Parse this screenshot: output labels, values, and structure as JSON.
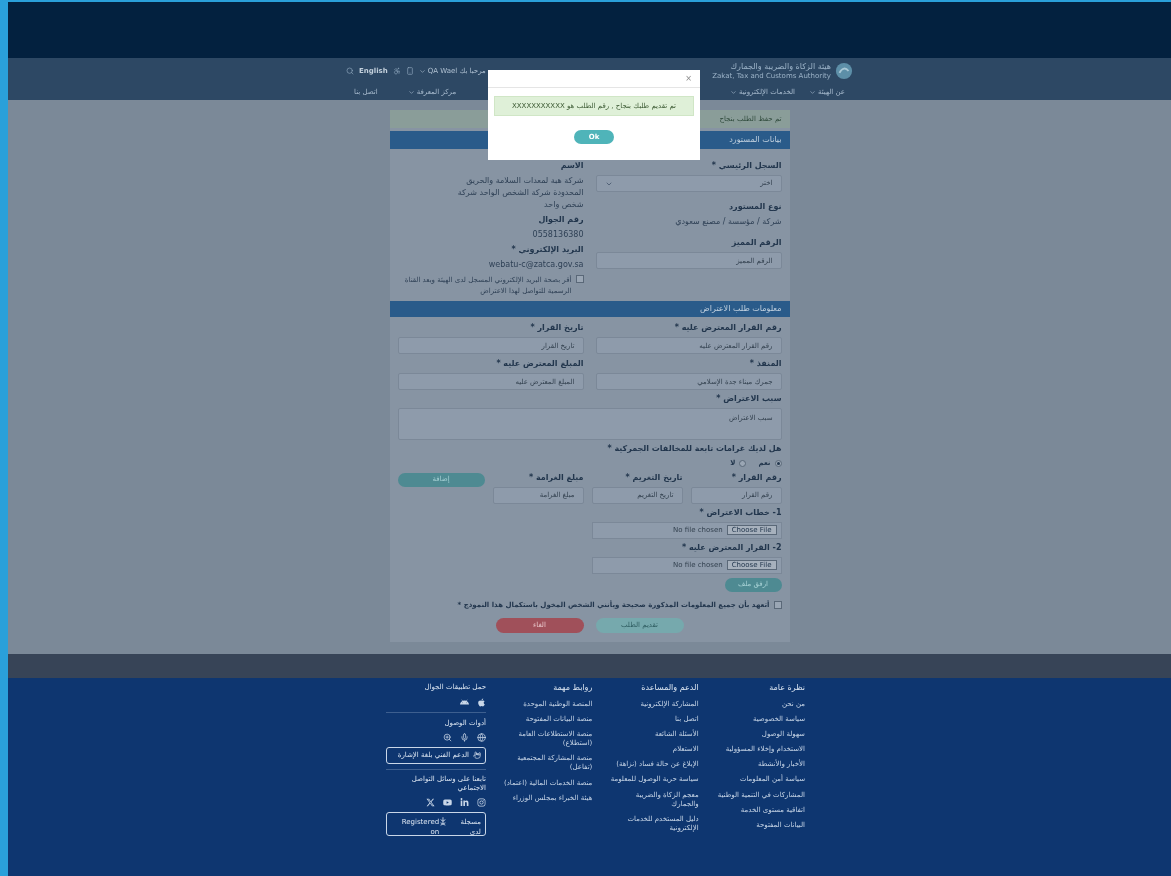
{
  "header": {
    "logo_title": "هيئة الزكاة والضريبة والجمارك",
    "logo_subtitle": "Zakat, Tax and Customs Authority",
    "greeting": "مرحبا بك QA Wael",
    "language": "English",
    "nav": [
      {
        "label": "عن الهيئة",
        "has_menu": true
      },
      {
        "label": "الخدمات الإلكترونية",
        "has_menu": true
      },
      {
        "label": "مركز المعرفة",
        "has_menu": true
      },
      {
        "label": "اتصل بنا",
        "has_menu": false
      }
    ]
  },
  "modal": {
    "close": "×",
    "message": "تم تقديم طلبك بنجاح , رقم الطلب هو XXXXXXXXXXX",
    "button": "Ok"
  },
  "form": {
    "alert": "تم حفظ الطلب بنجاح",
    "importer": {
      "title": "بيانات المستورد",
      "right_column": [
        {
          "kind": "select",
          "label": "السجل الرئيسي *",
          "value": "اختر"
        },
        {
          "kind": "readonly",
          "label": "نوع المستورد",
          "value": "شركة / مؤسسة / مصنع سعودي"
        },
        {
          "kind": "input",
          "label": "الرقم المميز",
          "placeholder": "الرقم المميز"
        }
      ],
      "left_column": [
        {
          "kind": "readonly",
          "label": "الاسم",
          "value": "شركة هبة لمعدات السلامة والحريق المحدودة شركة الشخص الواحد شركة شخص واحد"
        },
        {
          "kind": "readonly",
          "label": "رقم الجوال",
          "value": "0558136380"
        },
        {
          "kind": "email",
          "label": "البريد الإلكتروني *",
          "value": "webatu-c@zatca.gov.sa",
          "confirm": {
            "label": "أقر بصحة البريد الإلكتروني المسجل لدى الهيئة وبعد القناة الرسمية للتواصل لهذا الاعتراض",
            "checked": false
          }
        }
      ]
    },
    "objection": {
      "title": "معلومات طلب الاعتراض",
      "inputs": [
        {
          "label": "رقم القرار المعترض عليه *",
          "placeholder": "رقم القرار المعترض عليه"
        },
        {
          "label": "تاريخ القرار *",
          "placeholder": "تاريخ القرار"
        },
        {
          "label": "المنفذ *",
          "placeholder": "جمرك ميناء جدة الإسلامي"
        },
        {
          "label": "المبلغ المعترض عليه *",
          "placeholder": "المبلغ المعترض عليه"
        }
      ],
      "reason": {
        "label": "سبب الاعتراض *",
        "placeholder": "سبب الاعتراض"
      },
      "fines_question": {
        "label": "هل لديك غرامات تابعة للمخالفات الجمركية *",
        "options": [
          {
            "label": "نعم",
            "selected": true
          },
          {
            "label": "لا",
            "selected": false
          }
        ]
      },
      "fines": [
        {
          "label": "رقم القرار *",
          "placeholder": "رقم القرار"
        },
        {
          "label": "تاريخ التغريم *",
          "placeholder": "تاريخ التغريم"
        },
        {
          "label": "مبلغ الغرامة *",
          "placeholder": "مبلغ الغرامة"
        }
      ],
      "add_button": "إضافة",
      "files": [
        {
          "label": "1- خطاب الاعتراض *",
          "button": "Choose File",
          "status": "No file chosen"
        },
        {
          "label": "2- القرار المعترض عليه *",
          "button": "Choose File",
          "status": "No file chosen"
        }
      ],
      "attach_button": "ارفق ملف",
      "pledge": {
        "label": "أتعهد بأن جميع المعلومات المذكورة صحيحة وبأنني الشخص المخول باستكمال هذا النموذج *",
        "checked": false
      },
      "submit": {
        "label": "تقديم الطلب",
        "disabled": true
      },
      "cancel": "الغاء"
    }
  },
  "footer": {
    "columns": [
      {
        "title": "نظرة عامة",
        "links": [
          "من نحن",
          "سياسة الخصوصية",
          "سهولة الوصول",
          "الاستخدام وإخلاء المسؤولية",
          "الأخبار والأنشطة",
          "سياسة أمن المعلومات",
          "المشاركات في التنمية الوطنية",
          "اتفاقية مستوى الخدمة",
          "البيانات المفتوحة"
        ]
      },
      {
        "title": "الدعم والمساعدة",
        "links": [
          "المشاركة الإلكترونية",
          "اتصل بنا",
          "الأسئلة الشائعة",
          "الاستعلام",
          "الإبلاغ عن حالة فساد (نزاهة)",
          "سياسة حرية الوصول للمعلومة",
          "معجم الزكاة والضريبة والجمارك",
          "دليل المستخدم للخدمات الإلكترونية"
        ]
      },
      {
        "title": "روابط مهمة",
        "links": [
          "المنصة الوطنية الموحدة",
          "منصة البيانات المفتوحة",
          "منصة الاستطلاعات العامة (استطلاع)",
          "منصة المشاركة المجتمعية (تفاعل)",
          "منصة الخدمات المالية (اعتماد)",
          "هيئة الخبراء بمجلس الوزراء"
        ]
      }
    ],
    "apps_title": "حمل تطبيقات الجوال",
    "access_title": "أدوات الوصول",
    "sign_language": "الدعم الفني بلغة الإشارة",
    "social_title": "تابعنا على وسائل التواصل الاجتماعي",
    "badge": {
      "left": "Registered on",
      "right": "مسجلة لدى"
    }
  }
}
